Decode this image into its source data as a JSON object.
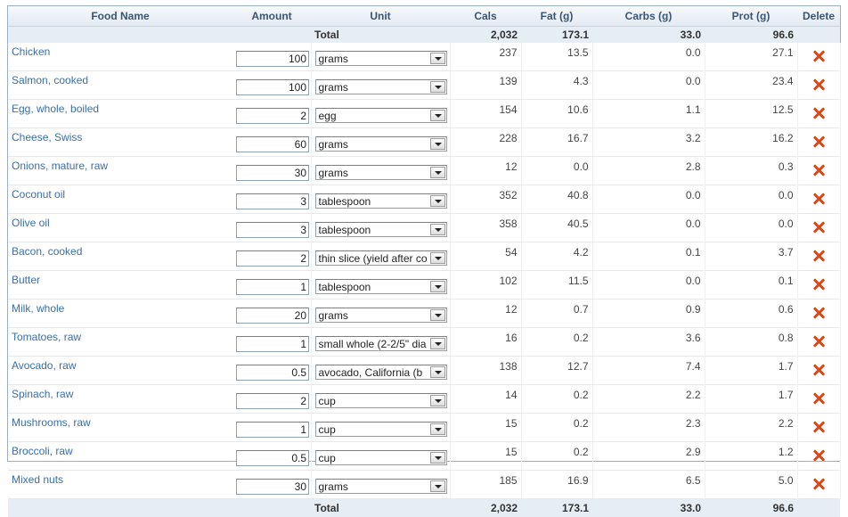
{
  "headers": {
    "food_name": "Food Name",
    "amount": "Amount",
    "unit": "Unit",
    "cals": "Cals",
    "fat": "Fat (g)",
    "carbs": "Carbs (g)",
    "prot": "Prot (g)",
    "delete": "Delete"
  },
  "total": {
    "label": "Total",
    "cals": "2,032",
    "fat": "173.1",
    "carbs": "33.0",
    "prot": "96.6"
  },
  "rows": [
    {
      "name": "Chicken",
      "amount": "100",
      "unit": "grams",
      "cals": "237",
      "fat": "13.5",
      "carbs": "0.0",
      "prot": "27.1"
    },
    {
      "name": "Salmon, cooked",
      "amount": "100",
      "unit": "grams",
      "cals": "139",
      "fat": "4.3",
      "carbs": "0.0",
      "prot": "23.4"
    },
    {
      "name": "Egg, whole, boiled",
      "amount": "2",
      "unit": "egg",
      "cals": "154",
      "fat": "10.6",
      "carbs": "1.1",
      "prot": "12.5"
    },
    {
      "name": "Cheese, Swiss",
      "amount": "60",
      "unit": "grams",
      "cals": "228",
      "fat": "16.7",
      "carbs": "3.2",
      "prot": "16.2"
    },
    {
      "name": "Onions, mature, raw",
      "amount": "30",
      "unit": "grams",
      "cals": "12",
      "fat": "0.0",
      "carbs": "2.8",
      "prot": "0.3"
    },
    {
      "name": "Coconut oil",
      "amount": "3",
      "unit": "tablespoon",
      "cals": "352",
      "fat": "40.8",
      "carbs": "0.0",
      "prot": "0.0"
    },
    {
      "name": "Olive oil",
      "amount": "3",
      "unit": "tablespoon",
      "cals": "358",
      "fat": "40.5",
      "carbs": "0.0",
      "prot": "0.0"
    },
    {
      "name": "Bacon, cooked",
      "amount": "2",
      "unit": "thin slice (yield after co",
      "cals": "54",
      "fat": "4.2",
      "carbs": "0.1",
      "prot": "3.7"
    },
    {
      "name": "Butter",
      "amount": "1",
      "unit": "tablespoon",
      "cals": "102",
      "fat": "11.5",
      "carbs": "0.0",
      "prot": "0.1"
    },
    {
      "name": "Milk, whole",
      "amount": "20",
      "unit": "grams",
      "cals": "12",
      "fat": "0.7",
      "carbs": "0.9",
      "prot": "0.6"
    },
    {
      "name": "Tomatoes, raw",
      "amount": "1",
      "unit": "small whole (2-2/5\" dia",
      "cals": "16",
      "fat": "0.2",
      "carbs": "3.6",
      "prot": "0.8"
    },
    {
      "name": "Avocado, raw",
      "amount": "0.5",
      "unit": "avocado, California (b",
      "cals": "138",
      "fat": "12.7",
      "carbs": "7.4",
      "prot": "1.7"
    },
    {
      "name": "Spinach, raw",
      "amount": "2",
      "unit": "cup",
      "cals": "14",
      "fat": "0.2",
      "carbs": "2.2",
      "prot": "1.7"
    },
    {
      "name": "Mushrooms, raw",
      "amount": "1",
      "unit": "cup",
      "cals": "15",
      "fat": "0.2",
      "carbs": "2.3",
      "prot": "2.2"
    },
    {
      "name": "Broccoli, raw",
      "amount": "0.5",
      "unit": "cup",
      "cals": "15",
      "fat": "0.2",
      "carbs": "2.9",
      "prot": "1.2"
    },
    {
      "name": "Mixed nuts",
      "amount": "30",
      "unit": "grams",
      "cals": "185",
      "fat": "16.9",
      "carbs": "6.5",
      "prot": "5.0"
    }
  ],
  "colors": {
    "link": "#3b6fa5",
    "header_text": "#3a5570",
    "total_bg": "#e6edf5",
    "delete_icon": "#d9471d"
  },
  "icons": {
    "delete": "delete-x-icon",
    "dropdown": "chevron-down-icon"
  }
}
